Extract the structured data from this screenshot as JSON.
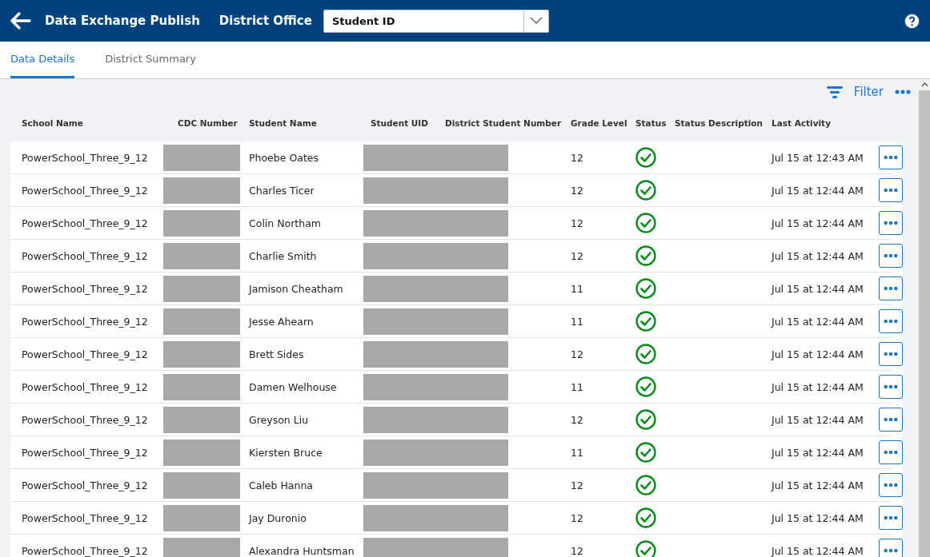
{
  "header": {
    "title": "Data Exchange Publish",
    "office": "District Office",
    "select": {
      "value": "Student ID"
    }
  },
  "tabs": [
    {
      "label": "Data Details",
      "selected": true
    },
    {
      "label": "District Summary",
      "selected": false
    }
  ],
  "toolbar": {
    "filter": "Filter"
  },
  "table": {
    "columns": [
      "School Name",
      "CDC Number",
      "Student Name",
      "Student UID",
      "District Student Number",
      "Grade Level",
      "Status",
      "Status Description",
      "Last Activity"
    ],
    "rows": [
      {
        "school": "PowerSchool_Three_9_12",
        "name": "Phoebe Oates",
        "grade": "12",
        "kind": "success",
        "activity": "Jul 15 at 12:43 AM"
      },
      {
        "school": "PowerSchool_Three_9_12",
        "name": "Charles Ticer",
        "grade": "12",
        "kind": "success",
        "activity": "Jul 15 at 12:44 AM"
      },
      {
        "school": "PowerSchool_Three_9_12",
        "name": "Colin Northam",
        "grade": "12",
        "kind": "success",
        "activity": "Jul 15 at 12:44 AM"
      },
      {
        "school": "PowerSchool_Three_9_12",
        "name": "Charlie Smith",
        "grade": "12",
        "kind": "success",
        "activity": "Jul 15 at 12:44 AM"
      },
      {
        "school": "PowerSchool_Three_9_12",
        "name": "Jamison Cheatham",
        "grade": "11",
        "kind": "success",
        "activity": "Jul 15 at 12:44 AM"
      },
      {
        "school": "PowerSchool_Three_9_12",
        "name": "Jesse Ahearn",
        "grade": "11",
        "kind": "success",
        "activity": "Jul 15 at 12:44 AM"
      },
      {
        "school": "PowerSchool_Three_9_12",
        "name": "Brett Sides",
        "grade": "12",
        "kind": "success",
        "activity": "Jul 15 at 12:44 AM"
      },
      {
        "school": "PowerSchool_Three_9_12",
        "name": "Damen Welhouse",
        "grade": "11",
        "kind": "success",
        "activity": "Jul 15 at 12:44 AM"
      },
      {
        "school": "PowerSchool_Three_9_12",
        "name": "Greyson Liu",
        "grade": "12",
        "kind": "success",
        "activity": "Jul 15 at 12:44 AM"
      },
      {
        "school": "PowerSchool_Three_9_12",
        "name": "Kiersten Bruce",
        "grade": "11",
        "kind": "success",
        "activity": "Jul 15 at 12:44 AM"
      },
      {
        "school": "PowerSchool_Three_9_12",
        "name": "Caleb Hanna",
        "grade": "12",
        "kind": "success",
        "activity": "Jul 15 at 12:44 AM"
      },
      {
        "school": "PowerSchool_Three_9_12",
        "name": "Jay Duronio",
        "grade": "12",
        "kind": "success",
        "activity": "Jul 15 at 12:44 AM"
      },
      {
        "school": "PowerSchool_Three_9_12",
        "name": "Alexandra Huntsman",
        "grade": "12",
        "kind": "success",
        "activity": "Jul 15 at 12:44 AM"
      }
    ]
  }
}
